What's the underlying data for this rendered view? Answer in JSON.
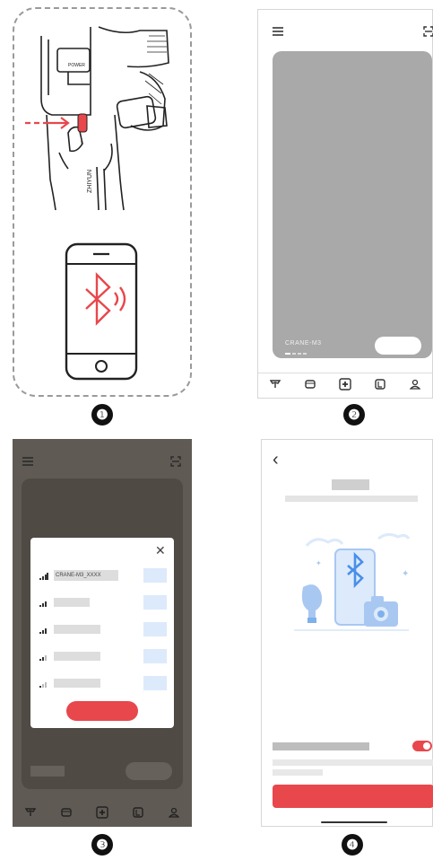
{
  "figures": [
    {
      "number": "❶"
    },
    {
      "number": "❷",
      "device_name": "CRANE-M3"
    },
    {
      "number": "❸",
      "dialog": {
        "close_glyph": "✕",
        "first_device": "CRANE-M3_XXXX"
      }
    },
    {
      "number": "❹",
      "back_glyph": "‹"
    }
  ],
  "colors": {
    "accent": "#e8474c",
    "blue": "#4a8fe8",
    "light_blue": "#dceafb",
    "gray_card": "#a9a9a9",
    "dark_overlay": "#5f5a53"
  }
}
